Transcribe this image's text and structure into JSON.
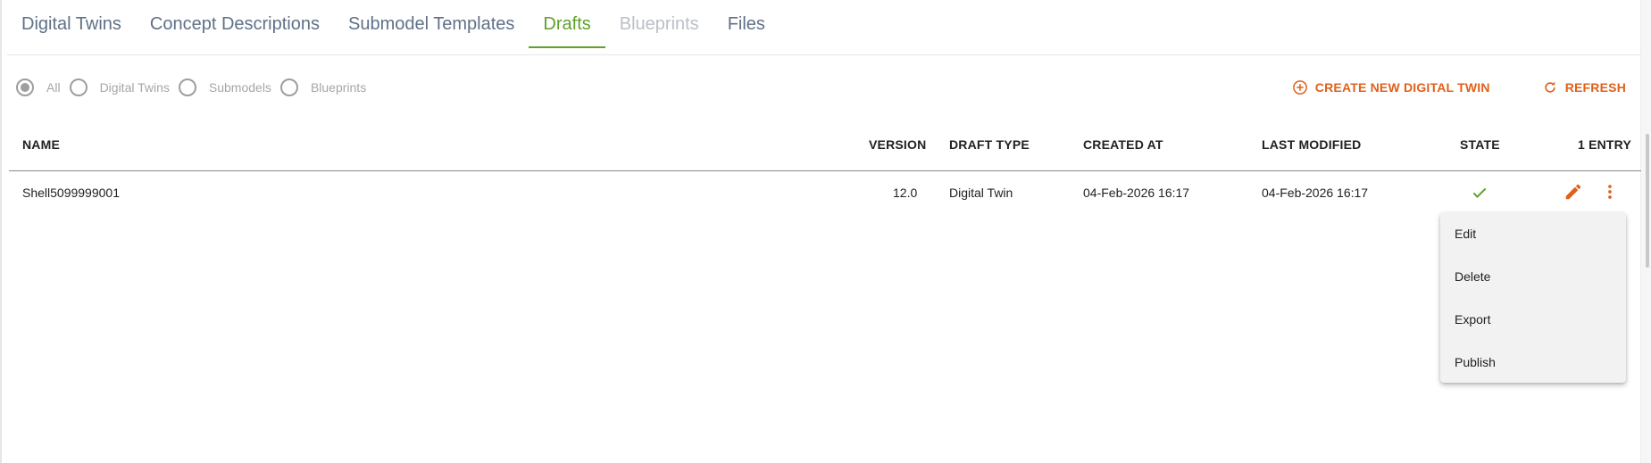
{
  "tabs": [
    {
      "label": "Digital Twins",
      "state": "normal"
    },
    {
      "label": "Concept Descriptions",
      "state": "normal"
    },
    {
      "label": "Submodel Templates",
      "state": "normal"
    },
    {
      "label": "Drafts",
      "state": "active"
    },
    {
      "label": "Blueprints",
      "state": "disabled"
    },
    {
      "label": "Files",
      "state": "normal"
    }
  ],
  "filters": {
    "selected": "All",
    "options": [
      {
        "label": "All"
      },
      {
        "label": "Digital Twins"
      },
      {
        "label": "Submodels"
      },
      {
        "label": "Blueprints"
      }
    ]
  },
  "actions": {
    "create_label": "CREATE NEW DIGITAL TWIN",
    "create_icon": "add-circle-icon",
    "refresh_label": "REFRESH",
    "refresh_icon": "refresh-icon"
  },
  "table": {
    "columns": {
      "name": "NAME",
      "version": "VERSION",
      "draft_type": "DRAFT TYPE",
      "created_at": "CREATED AT",
      "last_modified": "LAST MODIFIED",
      "state": "STATE",
      "entry_count": "1 ENTRY"
    },
    "rows": [
      {
        "name": "Shell5099999001",
        "version": "12.0",
        "draft_type": "Digital Twin",
        "created_at": "04-Feb-2026 16:17",
        "last_modified": "04-Feb-2026 16:17",
        "state_icon": "check-icon"
      }
    ]
  },
  "context_menu": {
    "items": [
      {
        "label": "Edit"
      },
      {
        "label": "Delete"
      },
      {
        "label": "Export"
      },
      {
        "label": "Publish"
      }
    ]
  },
  "colors": {
    "accent_green": "#5fa12a",
    "action_orange": "#e0601b",
    "tab_text": "#5f7187",
    "disabled_text": "#b9c0c8",
    "menu_bg": "#f2f2f2"
  }
}
